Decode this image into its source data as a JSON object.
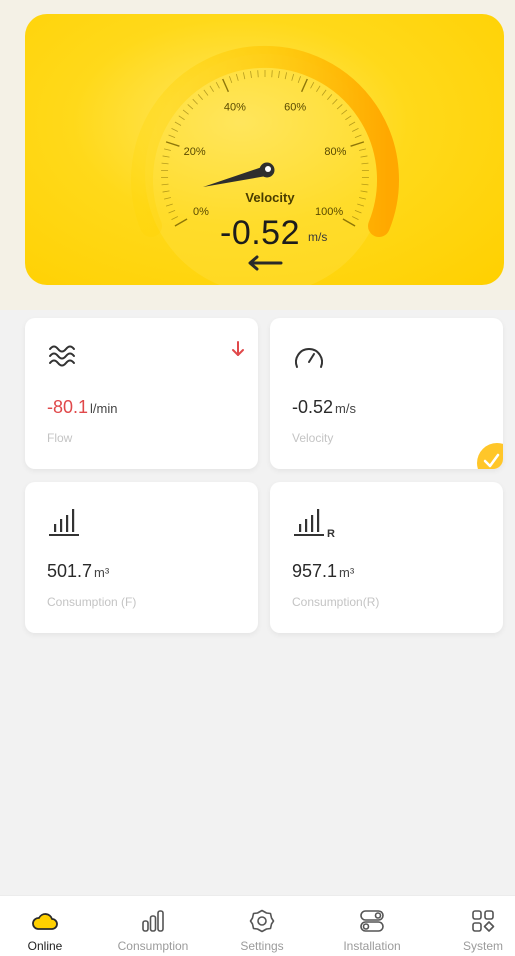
{
  "gauge": {
    "title": "Velocity",
    "value": "-0.52",
    "unit": "m/s",
    "level_percent": 0,
    "direction": "reverse",
    "tick_labels": [
      "0%",
      "20%",
      "40%",
      "60%",
      "80%",
      "100%"
    ],
    "accent_color": "#ffd000"
  },
  "cards": {
    "flow": {
      "value": "-80.1",
      "unit": "l/min",
      "caption": "Flow",
      "icon": "waves-icon",
      "trend_icon": "arrow-down-icon",
      "value_color": "#e0484a"
    },
    "velocity": {
      "value": "-0.52",
      "unit": "m/s",
      "caption": "Velocity",
      "icon": "speedometer-icon",
      "selected": true
    },
    "consumption_f": {
      "value": "501.7",
      "unit": "m³",
      "caption": "Consumption (F)",
      "icon": "bar-chart-icon"
    },
    "consumption_r": {
      "value": "957.1",
      "unit": "m³",
      "caption": "Consumption(R)",
      "icon": "bar-chart-r-icon",
      "icon_suffix": "R"
    }
  },
  "nav": {
    "items": [
      {
        "label": "Online",
        "icon": "cloud-icon",
        "active": true
      },
      {
        "label": "Consumption",
        "icon": "bars-icon",
        "active": false
      },
      {
        "label": "Settings",
        "icon": "gear-icon",
        "active": false
      },
      {
        "label": "Installation",
        "icon": "toggle-icon",
        "active": false
      },
      {
        "label": "System",
        "icon": "grid-icon",
        "active": false
      }
    ]
  }
}
